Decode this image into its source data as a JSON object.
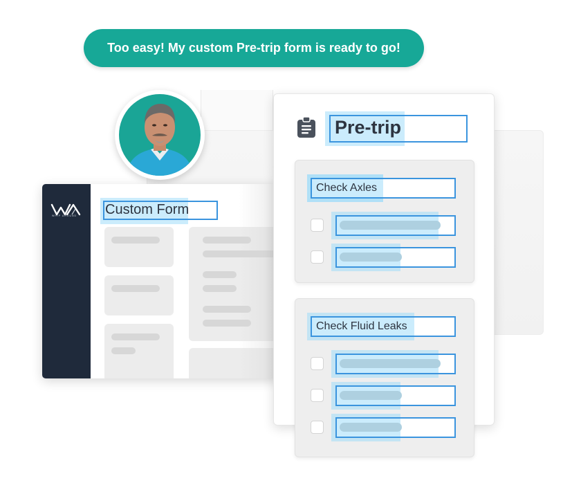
{
  "bubble": {
    "text": "Too easy! My custom Pre-trip form is ready to go!",
    "color": "#17a897"
  },
  "avatar": {
    "description": "user-photo",
    "background": "#1aa596"
  },
  "app": {
    "logo_sub": "WHIP AROUND",
    "title_field_value": "Custom Form",
    "sidebar_color": "#1f2a3b"
  },
  "pretrip": {
    "icon": "clipboard-icon",
    "title": "Pre-trip",
    "sections": [
      {
        "title": "Check Axles",
        "items": [
          {
            "checked": false
          },
          {
            "checked": false
          }
        ]
      },
      {
        "title": "Check Fluid Leaks",
        "items": [
          {
            "checked": false
          },
          {
            "checked": false
          },
          {
            "checked": false
          }
        ]
      }
    ]
  },
  "colors": {
    "selection_highlight": "#c9ecfb",
    "field_border": "#3a94de",
    "placeholder_bar": "#aed0e0"
  }
}
